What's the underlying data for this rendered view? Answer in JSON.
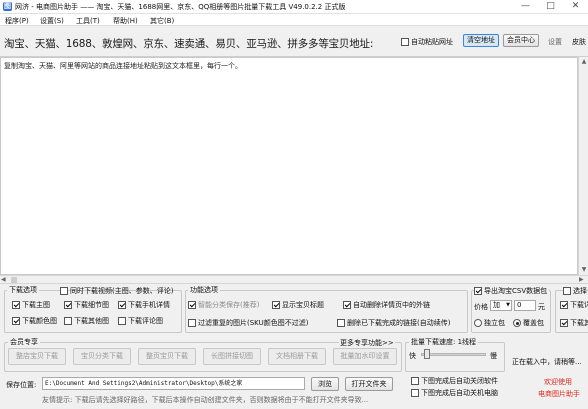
{
  "window": {
    "app_short": "网济",
    "title": "电商图片助手 —— 淘宝、天猫、1688网里、京东、QQ相册等图片批量下载工具 V49.0.2.2 正式版",
    "controls": [
      "—",
      "□",
      "✕"
    ]
  },
  "menu": [
    "程序(P)",
    "设置(S)",
    "工具(T)",
    "帮助(H)",
    "其它(B)"
  ],
  "url_bar": {
    "label": "淘宝、天猫、1688、敦煌网、京东、速卖通、易贝、亚马逊、拼多多等宝贝地址:",
    "auto_paste_label": "自动粘贴网址",
    "auto_paste_checked": false,
    "buttons": [
      "清空地址",
      "会员中心",
      "设置",
      "皮肤"
    ]
  },
  "textarea_placeholder": "复制淘宝、天猫、阿里等网站的商品连接地址粘贴到这文本框里，每行一个。",
  "download_options": {
    "title": "下载选项",
    "sync_detail_label": "同时下载视频(主图、参数、评论)",
    "sync_detail_checked": false,
    "items": [
      {
        "label": "下载主图",
        "checked": true
      },
      {
        "label": "下载细节图",
        "checked": true
      },
      {
        "label": "下载手机详情",
        "checked": true
      },
      {
        "label": "下载颜色图",
        "checked": true
      },
      {
        "label": "下载其他图",
        "checked": false
      },
      {
        "label": "下载评论图",
        "checked": false
      }
    ]
  },
  "function_options": {
    "title": "功能选项",
    "items": [
      {
        "label": "智能分类保存(推荐)",
        "checked": true,
        "disabled": true
      },
      {
        "label": "显示宝贝标题",
        "checked": true,
        "disabled": false
      },
      {
        "label": "自动删除详情页中的外链",
        "checked": true,
        "disabled": false
      },
      {
        "label": "过滤重复的图片(SKU颜色图不过滤)",
        "checked": false,
        "disabled": false
      },
      {
        "label": "删除已下载完成的链接(自动续传)",
        "checked": false,
        "disabled": false
      }
    ]
  },
  "export_group": {
    "export_label": "导出淘宝CSV数据包",
    "export_checked": true,
    "price_label": "价格",
    "price_op": "加",
    "price_value": "0",
    "price_unit": "元",
    "radio_independent": "独立包",
    "radio_merge": "覆盖包",
    "radio_selected": "merge"
  },
  "right_partial": {
    "label1": "选择",
    "label2": "下载详",
    "label3": "下载其"
  },
  "member": {
    "title": "会员专享",
    "more_label": "更多专享功能>>",
    "buttons": [
      "整店宝贝下载",
      "宝贝分类下载",
      "整页宝贝下载",
      "长图拼接切图",
      "文档相册下载",
      "批量加水印设置"
    ]
  },
  "threads": {
    "label": "批量下载速度: 1线程",
    "fast": "快",
    "slow": "慢",
    "value_fraction": 0.05
  },
  "save": {
    "label": "保存位置:",
    "path": "E:\\Document And Settings2\\Administrator\\Desktop\\系统之家",
    "browse": "浏览",
    "open": "打开文件夹"
  },
  "after_options": [
    {
      "label": "下图完成后自动关闭软件",
      "checked": false
    },
    {
      "label": "下图完成后自动关机电脑",
      "checked": false
    }
  ],
  "status": {
    "loading": "正在载入中，请稍等...",
    "welcome1": "欢迎使用",
    "welcome2": "电商图片助手",
    "tip": "友情提示: 下载后请先选择好路径，下载后本操作自动创建文件夹，否则数据将由于不能打开文件夹导致..."
  },
  "colors": {
    "accent": "#2d6fd0",
    "red": "#e0261a"
  }
}
